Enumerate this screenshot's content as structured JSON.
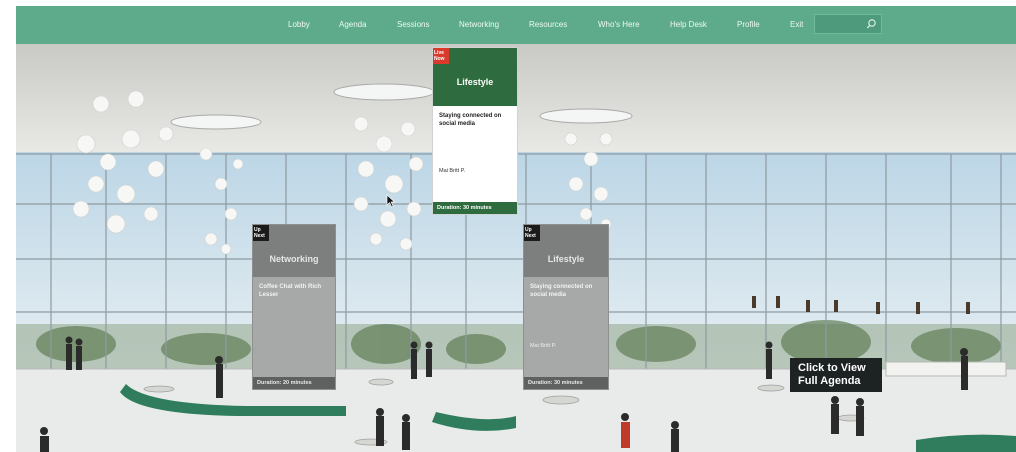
{
  "nav": {
    "items": [
      {
        "label": "Lobby"
      },
      {
        "label": "Agenda"
      },
      {
        "label": "Sessions"
      },
      {
        "label": "Networking"
      },
      {
        "label": "Resources"
      },
      {
        "label": "Who's Here"
      },
      {
        "label": "Help Desk"
      },
      {
        "label": "Profile"
      },
      {
        "label": "Exit"
      }
    ],
    "search": {
      "value": "",
      "placeholder": "",
      "icon": "search-icon"
    }
  },
  "cards": {
    "live": {
      "badge": "Live Now",
      "track": "Lifestyle",
      "title": "Staying connected on social media",
      "speaker": "Mai Britt P.",
      "duration": "Duration: 30 minutes",
      "header_color": "#2e6b3f",
      "badge_color": "#d93a2b"
    },
    "next_left": {
      "badge": "Up Next",
      "track": "Networking",
      "title": "Coffee Chat with Rich Lesser",
      "speaker": "",
      "duration": "Duration: 20 minutes"
    },
    "next_right": {
      "badge": "Up Next",
      "track": "Lifestyle",
      "title": "Staying connected on social media",
      "speaker": "Mai Britt P.",
      "duration": "Duration: 30 minutes"
    }
  },
  "agenda_button": {
    "line1": "Click to View",
    "line2": "Full Agenda"
  },
  "colors": {
    "nav": "#5eab8c",
    "accent_green": "#2e6b3f",
    "live_red": "#d93a2b"
  }
}
